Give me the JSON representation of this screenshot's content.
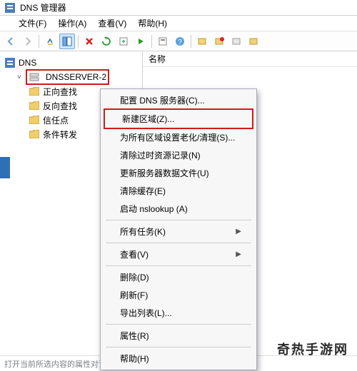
{
  "window": {
    "title": "DNS 管理器"
  },
  "menu_bar": {
    "file": "文件(F)",
    "action": "操作(A)",
    "view": "查看(V)",
    "help": "帮助(H)"
  },
  "toolbar": {
    "back": "后退",
    "forward": "前进",
    "up": "上一级",
    "panes": "窗格",
    "delete": "删除",
    "refresh": "刷新",
    "export": "导出",
    "start": "启动",
    "props": "属性",
    "help_btn": "帮助",
    "info1": "信息",
    "info2": "信息",
    "info3": "信息",
    "info4": "信息"
  },
  "left_pane": {
    "header": "",
    "root": "DNS",
    "server": "DNSSERVER-2",
    "children": [
      {
        "label": "正向查找"
      },
      {
        "label": "反向查找"
      },
      {
        "label": "信任点"
      },
      {
        "label": "条件转发"
      }
    ]
  },
  "right_pane": {
    "header": "名称"
  },
  "context_menu": {
    "configure": "配置 DNS 服务器(C)...",
    "new_zone": "新建区域(Z)...",
    "aging": "为所有区域设置老化/清理(S)...",
    "scavenge": "清除过时资源记录(N)",
    "update_data": "更新服务器数据文件(U)",
    "clear_cache": "清除缓存(E)",
    "nslookup": "启动 nslookup (A)",
    "all_tasks": "所有任务(K)",
    "view": "查看(V)",
    "delete": "删除(D)",
    "refresh": "刷新(F)",
    "export": "导出列表(L)...",
    "props": "属性(R)",
    "help": "帮助(H)"
  },
  "status_bar": {
    "text": "打开当前所选内容的属性对话框。"
  },
  "watermark": "奇热手游网",
  "colors": {
    "highlight": "#d01a1a",
    "sel_bg": "#cde6ff"
  }
}
